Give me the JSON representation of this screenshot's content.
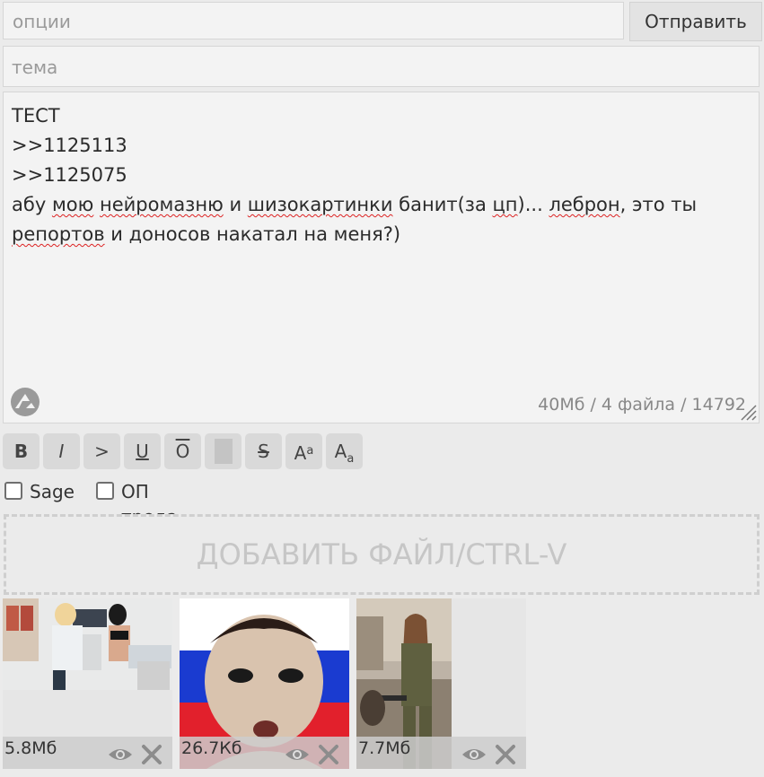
{
  "form": {
    "options_placeholder": "опции",
    "send_label": "Отправить",
    "subject_placeholder": "тема",
    "comment_lines": {
      "line1": "ТЕСТ",
      "line2": ">>1125113",
      "line3": ">>1125075",
      "line4_pre": "абу ",
      "w_moyu": "мою",
      "sp1": " ",
      "w_neiro": "нейромазню",
      "sp2": " и ",
      "w_shizo": "шизокартинки",
      "sp3": " банит(за ",
      "w_cp": "цп",
      "sp4": ")... ",
      "w_lebron": "леброн",
      "sp5": ", это ты ",
      "w_reportov": "репортов",
      "sp6": " и доносов накатал на меня?)"
    },
    "counter": "40Мб / 4 файла / 14792"
  },
  "toolbar": {
    "bold": "B",
    "italic": "I",
    "quote": ">",
    "underline": "U",
    "overline": "O",
    "strike": "S",
    "sup_main": "A",
    "sup_small": "a",
    "sub_main": "A",
    "sub_small": "a"
  },
  "checkboxes": {
    "sage": "Sage",
    "op": "ОП треда"
  },
  "dropzone_label": "ДОБАВИТЬ ФАЙЛ/CTRL-V",
  "files": [
    {
      "size": "5.8Мб"
    },
    {
      "size": "26.7Кб"
    },
    {
      "size": "7.7Мб"
    }
  ],
  "colors": {
    "background": "#ebebeb",
    "field": "#f3f3f3",
    "spell_underline": "#dd2222"
  }
}
